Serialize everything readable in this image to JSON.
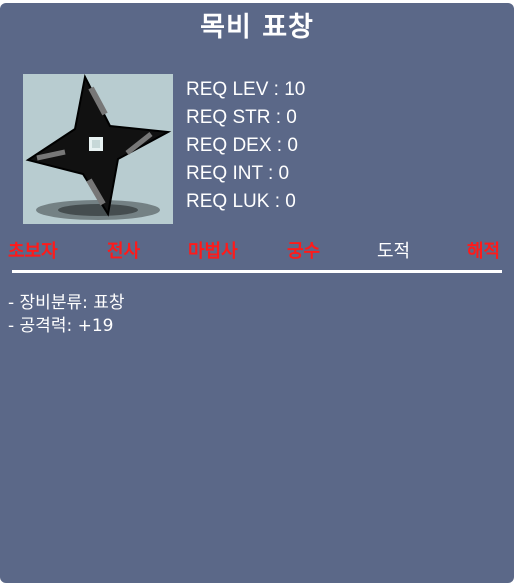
{
  "item": {
    "name": "목비 표창",
    "icon": "throwing-star-icon"
  },
  "requirements": [
    {
      "label": "REQ LEV : 10"
    },
    {
      "label": "REQ STR : 0"
    },
    {
      "label": "REQ DEX : 0"
    },
    {
      "label": "REQ INT : 0"
    },
    {
      "label": "REQ LUK : 0"
    }
  ],
  "jobs": [
    {
      "label": "초보자",
      "status": "unavailable"
    },
    {
      "label": "전사",
      "status": "unavailable"
    },
    {
      "label": "마법사",
      "status": "unavailable"
    },
    {
      "label": "궁수",
      "status": "unavailable"
    },
    {
      "label": "도적",
      "status": "available"
    },
    {
      "label": "해적",
      "status": "unavailable"
    }
  ],
  "stats": [
    {
      "label": "- 장비분류: 표창"
    },
    {
      "label": "- 공격력: +19"
    }
  ],
  "colors": {
    "panel_bg": "#5b6888",
    "unavailable_job": "#ff1a1a",
    "available_job": "#ffffff",
    "icon_bg": "#b8ccd0"
  }
}
